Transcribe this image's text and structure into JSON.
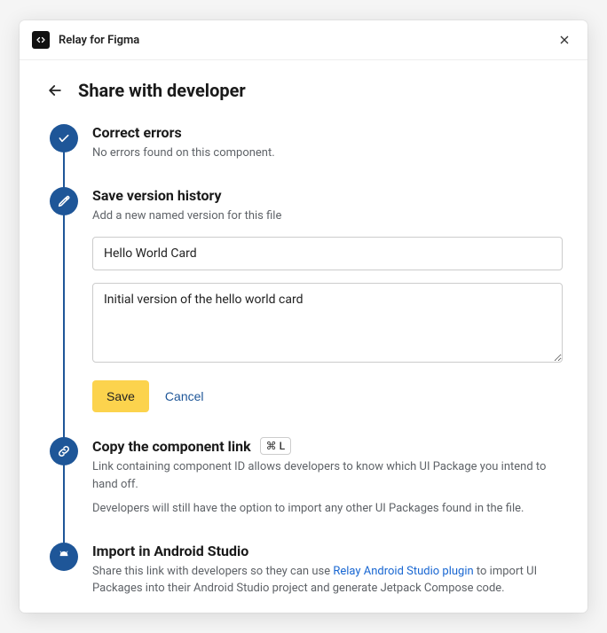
{
  "titlebar": {
    "app_name": "Relay for Figma"
  },
  "header": {
    "title": "Share with developer"
  },
  "steps": {
    "correct": {
      "title": "Correct errors",
      "desc": "No errors found on this component."
    },
    "save": {
      "title": "Save version history",
      "desc": "Add a new named version for this file",
      "name_value": "Hello World Card",
      "desc_value": "Initial version of the hello world card",
      "save_label": "Save",
      "cancel_label": "Cancel"
    },
    "copy": {
      "title": "Copy the component link",
      "shortcut": "⌘ L",
      "desc1": "Link containing component ID allows developers to know which UI Package you intend to hand off.",
      "desc2": "Developers will still have the option to import any other UI Packages found in the file."
    },
    "import": {
      "title": "Import in Android Studio",
      "desc_pre": "Share this link with developers so they can use ",
      "link_text": "Relay Android Studio plugin",
      "desc_post": " to import UI Packages into their Android Studio project and generate Jetpack Compose code."
    }
  }
}
